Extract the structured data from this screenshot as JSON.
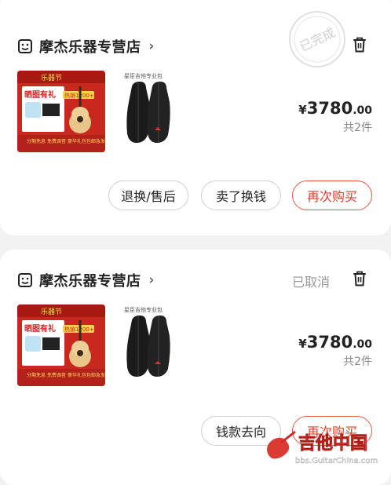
{
  "orders": [
    {
      "store_name": "摩杰乐器专营店",
      "chevron": "›",
      "status_stamp": "已完成",
      "product_thumb": {
        "banner_top": "乐器节",
        "promo": "晒图有礼",
        "badge": "热销1200+",
        "tags": [
          "分期免息",
          "免费调音",
          "豪华礼包",
          "包邮急发"
        ]
      },
      "bag_caption": "星臣吉他专业包",
      "price": {
        "yen": "¥",
        "int": "3780",
        "dec": ".00"
      },
      "count": "共2件",
      "buttons": {
        "return": "退换/售后",
        "resell": "卖了换钱",
        "rebuy": "再次购买"
      }
    },
    {
      "store_name": "摩杰乐器专营店",
      "chevron": "›",
      "status": "已取消",
      "product_thumb": {
        "banner_top": "乐器节",
        "promo": "晒图有礼",
        "badge": "热销1200+",
        "tags": [
          "分期免息",
          "免费调音",
          "豪华礼包",
          "包邮急发"
        ]
      },
      "bag_caption": "星臣吉他专业包",
      "price": {
        "yen": "¥",
        "int": "3780",
        "dec": ".00"
      },
      "count": "共2件",
      "buttons": {
        "refund_track": "钱款去向",
        "rebuy": "再次购买"
      }
    }
  ],
  "watermark": {
    "title": "吉他中国",
    "url": "bbs.GuitarChina.com"
  },
  "colors": {
    "accent_red": "#e23c2a",
    "muted": "#999999"
  }
}
